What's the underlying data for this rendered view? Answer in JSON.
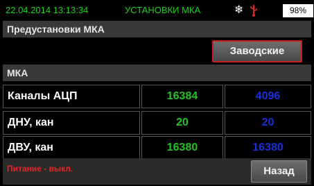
{
  "status": {
    "datetime": "22.04.2014  13:13:34",
    "title": "УСТАНОВКИ МКА",
    "battery": "98%",
    "icons": [
      "snowflake-icon",
      "usb-icon"
    ]
  },
  "sections": {
    "presets": "Предустановки МКА",
    "mka": "МКА"
  },
  "buttons": {
    "factory": "Заводские",
    "back": "Назад"
  },
  "table": [
    {
      "label": "Каналы АЦП",
      "v1": "16384",
      "v2": "4096"
    },
    {
      "label": "ДНУ, кан",
      "v1": "20",
      "v2": "20"
    },
    {
      "label": "ДВУ, кан",
      "v1": "16380",
      "v2": "16380"
    }
  ],
  "footer": {
    "power": "Питание - выкл."
  },
  "colors": {
    "green": "#19d319",
    "blue": "#1a2fd9",
    "red": "#e3262b"
  }
}
